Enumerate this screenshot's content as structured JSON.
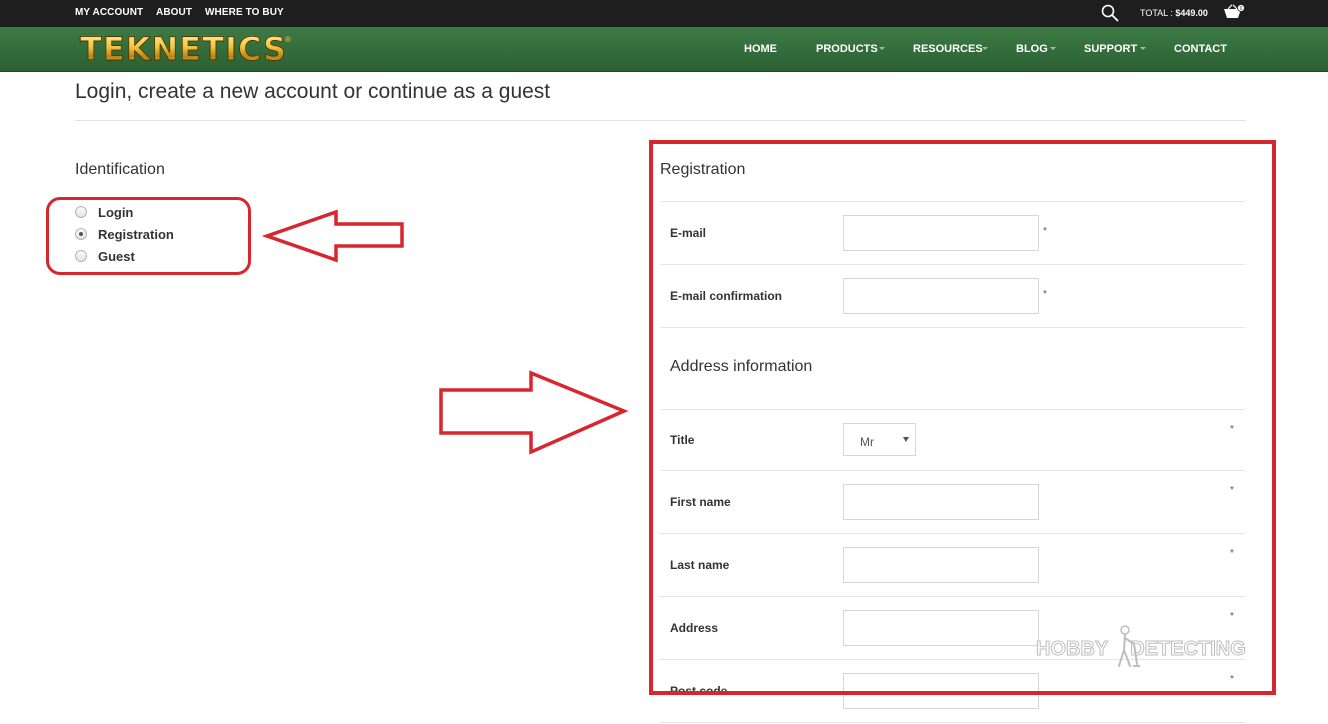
{
  "topbar": {
    "links": [
      "MY ACCOUNT",
      "ABOUT",
      "WHERE TO BUY"
    ],
    "cart_total_label": "TOTAL : ",
    "cart_total_value": "$449.00",
    "cart_count": "0"
  },
  "brand": {
    "logo_text": "TEKNETICS",
    "registered_mark": "®"
  },
  "nav": {
    "items": [
      {
        "label": "HOME"
      },
      {
        "label": "PRODUCTS"
      },
      {
        "label": "RESOURCES"
      },
      {
        "label": "BLOG"
      },
      {
        "label": "SUPPORT"
      },
      {
        "label": "CONTACT"
      }
    ]
  },
  "page": {
    "title": "Login, create a new account or continue as a guest"
  },
  "identification": {
    "title": "Identification",
    "options": [
      {
        "label": "Login",
        "checked": false
      },
      {
        "label": "Registration",
        "checked": true
      },
      {
        "label": "Guest",
        "checked": false
      }
    ]
  },
  "registration": {
    "title": "Registration",
    "email_label": "E-mail",
    "email_confirm_label": "E-mail confirmation",
    "address_title": "Address information",
    "title_label": "Title",
    "title_value": "Mr",
    "first_name_label": "First name",
    "last_name_label": "Last name",
    "address_label": "Address",
    "post_code_label": "Post code",
    "required_mark": "*"
  },
  "watermark": {
    "left": "HOBBY",
    "right": "DETECTING"
  },
  "colors": {
    "nav_green": "#2f6b38",
    "annotation_red": "#d8262f",
    "topbar": "#1e1e1e"
  },
  "icons": [
    "search-icon",
    "cart-icon",
    "left-arrow-icon",
    "right-arrow-icon"
  ]
}
